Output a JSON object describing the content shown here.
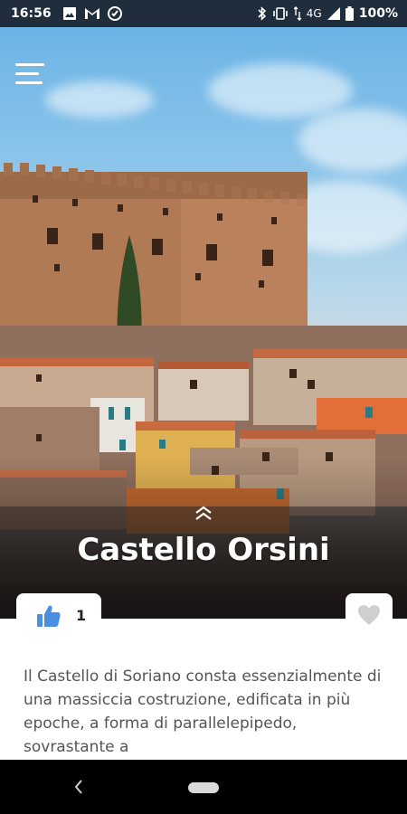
{
  "status_bar": {
    "time": "16:56",
    "network": "4G",
    "battery_percent": "100%",
    "icons_left": [
      "image-icon",
      "gmail-icon",
      "vpn-icon"
    ],
    "icons_right": [
      "bluetooth-icon",
      "vibrate-icon",
      "data-arrows-icon",
      "signal-icon",
      "battery-icon"
    ]
  },
  "header": {
    "menu_icon": "hamburger-menu-icon"
  },
  "place": {
    "title": "Castello Orsini",
    "likes": "1",
    "description": "Il Castello di Soriano consta essenzialmente di una massiccia costruzione, edificata in più epoche, a forma di parallelepipedo, sovrastante a"
  },
  "colors": {
    "status_bar_bg": "#1f2d3d",
    "like_blue": "#4a90e2",
    "heart_gray": "#cfcfcf",
    "text_gray": "#555555"
  },
  "nav_bar": {
    "back_icon": "back-chevron-icon",
    "home_icon": "home-pill-icon"
  }
}
